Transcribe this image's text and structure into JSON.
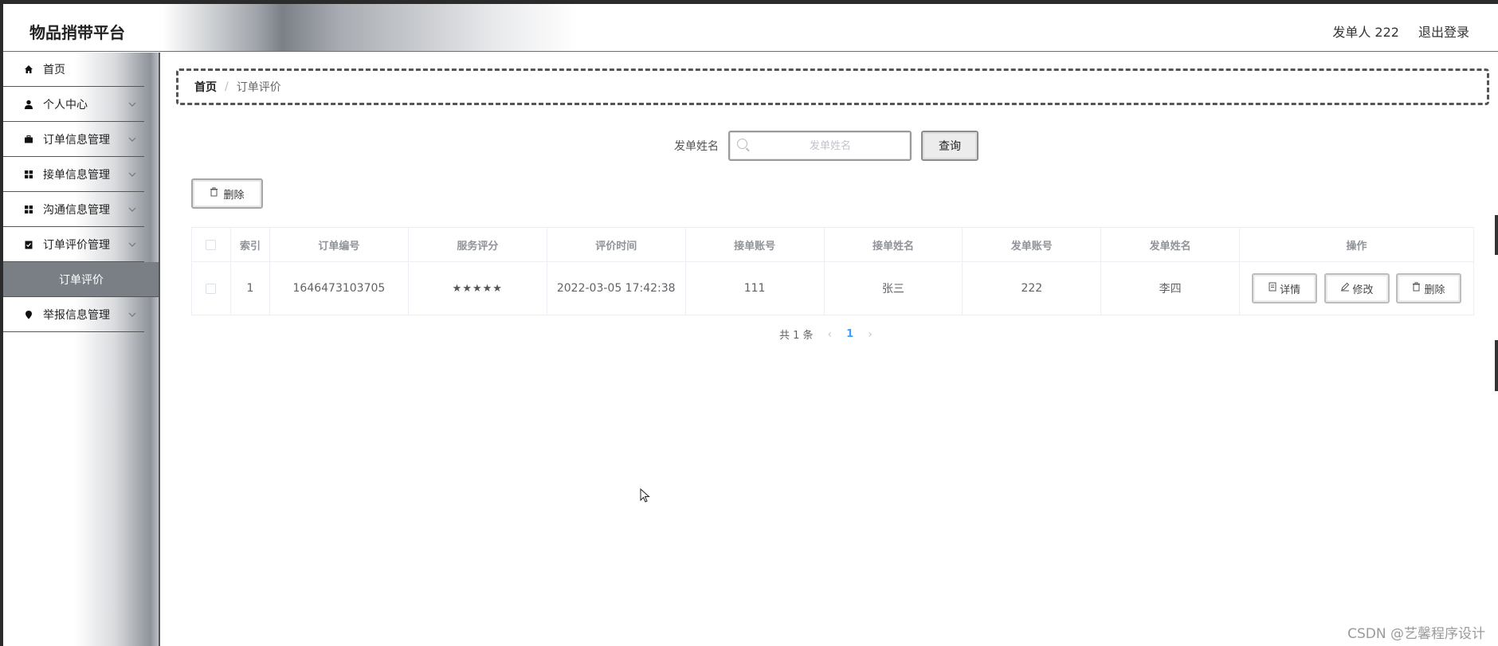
{
  "app": {
    "brand": "物品捎带平台",
    "header_user": "发单人 222",
    "logout_label": "退出登录"
  },
  "sidebar": {
    "items": [
      {
        "label": "首页",
        "icon": "home-icon"
      },
      {
        "label": "个人中心",
        "icon": "user-icon"
      },
      {
        "label": "订单信息管理",
        "icon": "briefcase-icon"
      },
      {
        "label": "接单信息管理",
        "icon": "grid-icon"
      },
      {
        "label": "沟通信息管理",
        "icon": "grid-icon"
      },
      {
        "label": "订单评价管理",
        "icon": "clipboard-check-icon"
      },
      {
        "label": "举报信息管理",
        "icon": "pin-icon"
      }
    ],
    "subitem": {
      "label": "订单评价"
    }
  },
  "breadcrumb": {
    "home": "首页",
    "separator": "/",
    "current": "订单评价"
  },
  "search": {
    "label": "发单姓名",
    "placeholder": "发单姓名",
    "value": "",
    "button_label": "查询"
  },
  "toolbar": {
    "delete_label": "删除"
  },
  "table": {
    "headers": [
      "索引",
      "订单编号",
      "服务评分",
      "评价时间",
      "接单账号",
      "接单姓名",
      "发单账号",
      "发单姓名",
      "操作"
    ],
    "rows": [
      {
        "index": "1",
        "order_no": "1646473103705",
        "rating": "★★★★★",
        "eval_time": "2022-03-05 17:42:38",
        "taker_account": "111",
        "taker_name": "张三",
        "sender_account": "222",
        "sender_name": "李四",
        "actions": {
          "detail": "详情",
          "edit": "修改",
          "delete": "删除"
        }
      }
    ]
  },
  "pagination": {
    "total_text": "共 1 条",
    "current_page": "1",
    "prev": "‹",
    "next": "›"
  },
  "watermark": "CSDN @艺馨程序设计"
}
